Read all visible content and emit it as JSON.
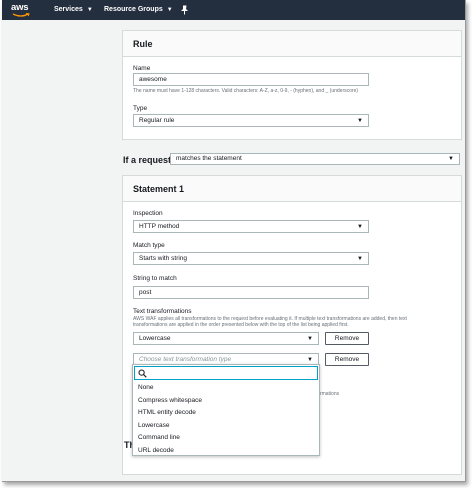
{
  "nav": {
    "logo_text": "aws",
    "services_label": "Services",
    "resource_groups_label": "Resource Groups",
    "pin_icon": "pin-icon"
  },
  "rule_panel": {
    "title": "Rule",
    "name_label": "Name",
    "name_value": "awesome",
    "name_hint": "The name must have 1-128 characters. Valid characters: A-Z, a-z, 0-9, - (hyphen), and _ (underscore)",
    "type_label": "Type",
    "type_value": "Regular rule"
  },
  "if_request": {
    "label": "If a request",
    "value": "matches the statement"
  },
  "statement_panel": {
    "title": "Statement 1",
    "inspection_label": "Inspection",
    "inspection_value": "HTTP method",
    "match_type_label": "Match type",
    "match_type_value": "Starts with string",
    "string_label": "String to match",
    "string_value": "post",
    "transforms_label": "Text transformations",
    "transforms_hint_1": "AWS WAF applies all transformations to the request before evaluating it. If multiple text transformations are added, then text",
    "transforms_hint_2": "transformations are applied in the order presented below with the top of the list being applied first.",
    "transform_1_value": "Lowercase",
    "transform_2_placeholder": "Choose text transformation type",
    "remove_label": "Remove",
    "partial_text": "nformations"
  },
  "dropdown": {
    "search_value": "",
    "options": [
      "None",
      "Compress whitespace",
      "HTML entity decode",
      "Lowercase",
      "Command line",
      "URL decode"
    ]
  },
  "partial_heading": "Th"
}
